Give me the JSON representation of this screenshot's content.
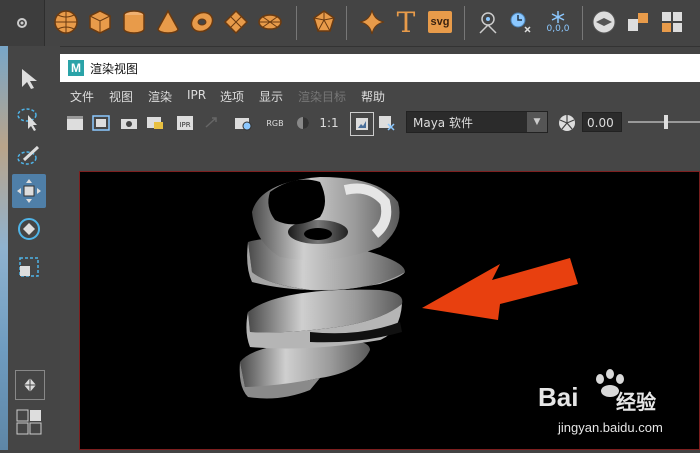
{
  "window": {
    "title": "渲染视图",
    "app_icon_letter": "M"
  },
  "menu": [
    "文件",
    "视图",
    "渲染",
    "IPR",
    "选项",
    "显示",
    "渲染目标",
    "帮助"
  ],
  "toolbar": {
    "resolution_label": "1:1",
    "rgb_label": "RGB",
    "renderer": "Maya 软件",
    "exposure": "0.00"
  },
  "shelf": {
    "text_icon": "T",
    "svg_icon": "svg",
    "coord_label": "0,0,0"
  },
  "watermark": {
    "brand": "Bai",
    "brand_suffix": "经验",
    "url": "jingyan.baidu.com"
  },
  "colors": {
    "shelf_icon": "#e89b4a",
    "accent_blue": "#4f7fa8",
    "arrow_red": "#e8400f",
    "maya_teal": "#2aa3a8"
  },
  "icons": [
    "settings-icon",
    "sphere-icon",
    "cube-icon",
    "cylinder-icon",
    "cone-icon",
    "torus-icon",
    "plane-icon",
    "disc-icon",
    "platonic-icon",
    "star-icon",
    "text-icon",
    "svg-icon",
    "pivot-icon",
    "timer-icon",
    "freeze-icon",
    "shelf-icon",
    "combine-icon",
    "separate-icon",
    "select-tool-icon",
    "lasso-tool-icon",
    "paint-tool-icon",
    "move-tool-icon",
    "rotate-tool-icon",
    "scale-tool-icon",
    "layout-single-icon",
    "layout-quad-icon"
  ]
}
